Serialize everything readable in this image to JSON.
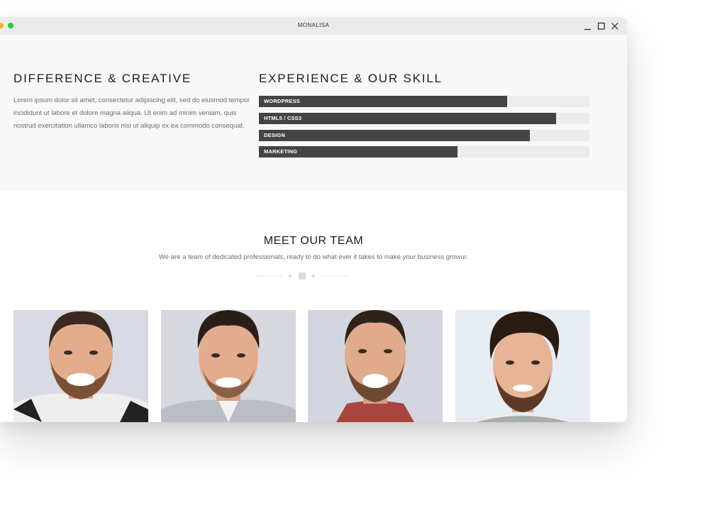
{
  "window": {
    "title": "MONALISA",
    "accent_colors": {
      "yellow": "#f5b520",
      "green": "#27c840"
    }
  },
  "about": {
    "heading": "DIFFERENCE & CREATIVE",
    "text": "Lorem ipsum dolor sit amet, consectetur adipiscing elit, sed do eiusmod tempor incididunt ut labore et dolore magna aliqua. Ut enim ad minim veniam, quis nostrud exercitation ullamco laboris nisi ut aliquip ex ea commodo consequat."
  },
  "skills": {
    "heading": "EXPERIENCE & OUR SKILL",
    "bar_color": "#444444",
    "items": [
      {
        "label": "WORDPRESS",
        "percent": 75
      },
      {
        "label": "HTML5 / CSS3",
        "percent": 90
      },
      {
        "label": "DESIGN",
        "percent": 82
      },
      {
        "label": "MARKETING",
        "percent": 60
      }
    ]
  },
  "team": {
    "heading": "MEET OUR TEAM",
    "subtitle": "We are a team of dedicated professionals, ready to do what ever it takes to make your business growur.",
    "members": [
      {
        "photo": "smiling-man-photo-1"
      },
      {
        "photo": "smiling-man-photo-2"
      },
      {
        "photo": "smiling-man-photo-3"
      },
      {
        "photo": "smiling-man-photo-4"
      }
    ]
  }
}
